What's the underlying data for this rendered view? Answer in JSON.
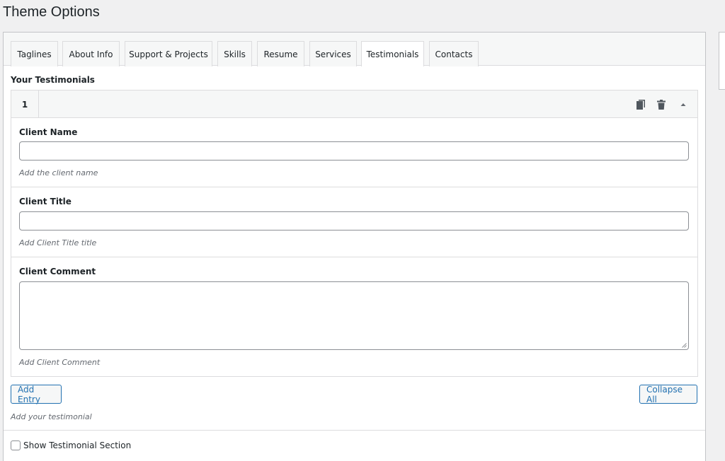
{
  "page": {
    "title": "Theme Options"
  },
  "tabs": [
    {
      "label": "Taglines"
    },
    {
      "label": "About Info"
    },
    {
      "label": "Support & Projects"
    },
    {
      "label": "Skills"
    },
    {
      "label": "Resume"
    },
    {
      "label": "Services"
    },
    {
      "label": "Testimonials",
      "active": true
    },
    {
      "label": "Contacts"
    }
  ],
  "section": {
    "label": "Your Testimonials"
  },
  "entry": {
    "number": "1",
    "icons": [
      "copy-icon",
      "trash-icon",
      "collapse-arrow-icon"
    ],
    "fields": {
      "client_name": {
        "label": "Client Name",
        "value": "",
        "description": "Add the client name"
      },
      "client_title": {
        "label": "Client Title",
        "value": "",
        "description": "Add Client Title title"
      },
      "client_comment": {
        "label": "Client Comment",
        "value": "",
        "description": "Add Client Comment"
      }
    }
  },
  "actions": {
    "add_entry": "Add Entry",
    "collapse_all": "Collapse All",
    "add_description": "Add your testimonial"
  },
  "options": {
    "show_section_label": "Show Testimonial Section",
    "show_section_checked": false
  },
  "colors": {
    "accent": "#2271b1",
    "border": "#dcdcde",
    "background": "#f0f0f1"
  }
}
